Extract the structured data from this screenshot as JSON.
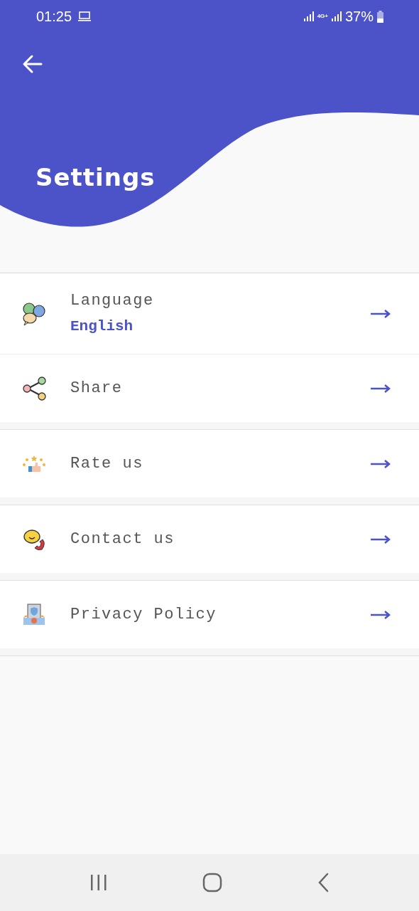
{
  "status_bar": {
    "time": "01:25",
    "network": "4G+",
    "battery": "37%"
  },
  "header": {
    "title": "Settings"
  },
  "items": [
    {
      "label": "Language",
      "value": "English"
    },
    {
      "label": "Share"
    },
    {
      "label": "Rate us"
    },
    {
      "label": "Contact us"
    },
    {
      "label": "Privacy Policy"
    }
  ]
}
